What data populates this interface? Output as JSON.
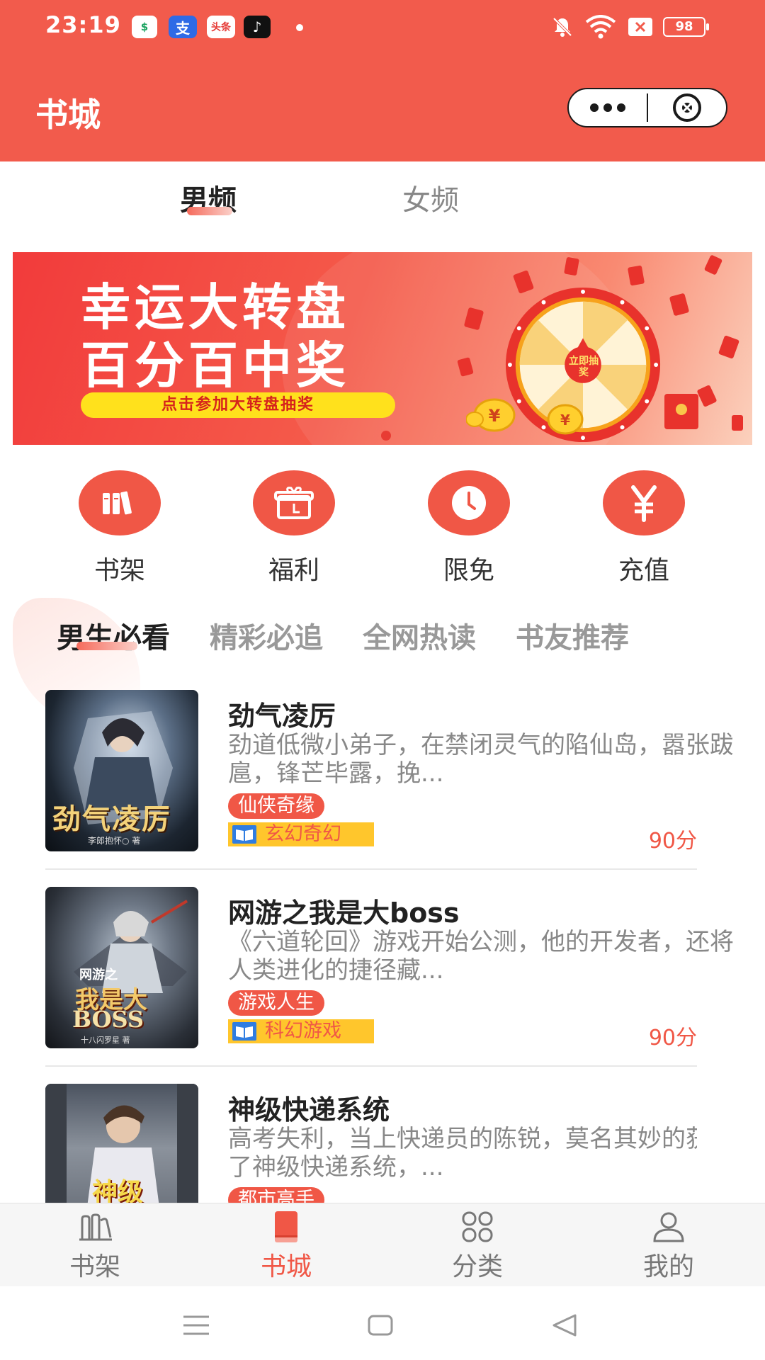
{
  "status_bar": {
    "time": "23:19",
    "notif_icons": [
      "security-badge-icon",
      "alipay-icon",
      "toutiao-icon",
      "tiktok-icon"
    ],
    "toutiao_label": "头条",
    "battery": "98"
  },
  "header": {
    "title": "书城",
    "bg_color": "#f25b4c"
  },
  "gender_tabs": [
    {
      "label": "男频",
      "active": true
    },
    {
      "label": "女频",
      "active": false
    }
  ],
  "banner": {
    "line1": "幸运大转盘",
    "line2": "百分百中奖",
    "cta": "点击参加大转盘抽奖",
    "wheel_center": "立即抽奖"
  },
  "quick_links": [
    {
      "label": "书架",
      "icon": "bookshelf-icon"
    },
    {
      "label": "福利",
      "icon": "gift-icon"
    },
    {
      "label": "限免",
      "icon": "clock-icon"
    },
    {
      "label": "充值",
      "icon": "yuan-icon"
    }
  ],
  "section_tabs": [
    {
      "label": "男生必看",
      "active": true
    },
    {
      "label": "精彩必追",
      "active": false
    },
    {
      "label": "全网热读",
      "active": false
    },
    {
      "label": "书友推荐",
      "active": false
    }
  ],
  "books": [
    {
      "title": "劲气凌厉",
      "desc": "劲道低微小弟子，在禁闭灵气的陷仙岛，嚣张跋扈，锋芒毕露，挽...",
      "tag": "仙侠奇缘",
      "genre": "玄幻奇幻",
      "score": "90分",
      "cover_title": "劲气凌厉",
      "cover_author": "李郎抱怀○ 著"
    },
    {
      "title": "网游之我是大boss",
      "desc": "《六道轮回》游戏开始公测，他的开发者，还将人类进化的捷径藏...",
      "tag": "游戏人生",
      "genre": "科幻游戏",
      "score": "90分",
      "cover_title_small": "网游之",
      "cover_title": "我是大",
      "cover_title2": "BOSS",
      "cover_author": "十八闪罗星 著"
    },
    {
      "title": "神级快递系统",
      "desc": "高考失利，当上快递员的陈锐，莫名其妙的获得了神级快递系统，...",
      "tag": "都市高手",
      "cover_title": "神级"
    }
  ],
  "tab_bar": [
    {
      "label": "书架",
      "icon": "bookshelf-outline-icon",
      "active": false
    },
    {
      "label": "书城",
      "icon": "book-icon",
      "active": true
    },
    {
      "label": "分类",
      "icon": "category-grid-icon",
      "active": false
    },
    {
      "label": "我的",
      "icon": "user-icon",
      "active": false
    }
  ],
  "colors": {
    "accent": "#f05746",
    "tag_yellow": "#ffc62c",
    "inactive_text": "#888888"
  }
}
